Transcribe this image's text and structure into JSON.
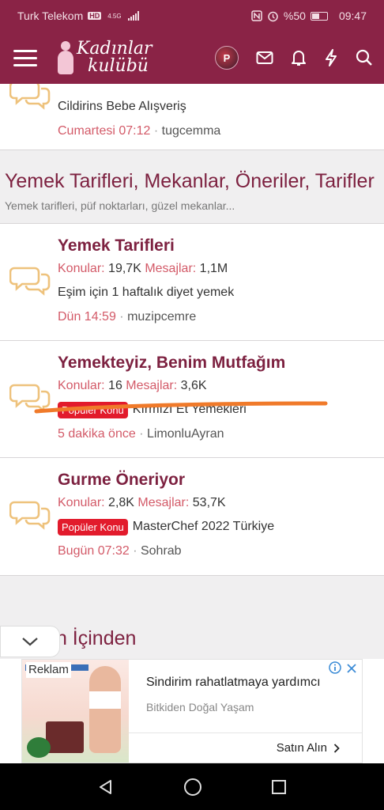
{
  "status_bar": {
    "carrier": "Turk Telekom",
    "hd_badge": "HD",
    "network": "4.5G",
    "battery": "%50",
    "time": "09:47"
  },
  "header": {
    "logo_line1": "Kadınlar",
    "logo_line2": "kulübü",
    "avatar_letter": "P"
  },
  "top_partial": {
    "last_title": "Cildirins Bebe Alışveriş",
    "time": "Cumartesi 07:12",
    "separator": "·",
    "user": "tugcemma"
  },
  "category": {
    "title": "Yemek Tarifleri, Mekanlar, Öneriler, Tarifler",
    "description": "Yemek tarifleri, püf noktarları, güzel mekanlar..."
  },
  "nodes": [
    {
      "title": "Yemek Tarifleri",
      "threads_label": "Konular:",
      "threads": "19,7K",
      "messages_label": "Mesajlar:",
      "messages": "1,1M",
      "badge": "",
      "last_title": "Eşim için 1 haftalık diyet yemek",
      "time": "Dün 14:59",
      "separator": "·",
      "user": "muzipcemre"
    },
    {
      "title": "Yemekteyiz, Benim Mutfağım",
      "threads_label": "Konular:",
      "threads": "16",
      "messages_label": "Mesajlar:",
      "messages": "3,6K",
      "badge": "Popüler Konu",
      "last_title": "Kırmızı Et Yemekleri",
      "time": "5 dakika önce",
      "separator": "·",
      "user": "LimonluAyran"
    },
    {
      "title": "Gurme Öneriyor",
      "threads_label": "Konular:",
      "threads": "2,8K",
      "messages_label": "Mesajlar:",
      "messages": "53,7K",
      "badge": "Popüler Konu",
      "last_title": "MasterChef 2022 Türkiye",
      "time": "Bugün 07:32",
      "separator": "·",
      "user": "Sohrab"
    }
  ],
  "next_category_partial": "ın İçinden",
  "ad": {
    "label": "Reklam",
    "headline": "Sindirim rahatlatmaya yardımcı",
    "advertiser": "Bitkiden Doğal Yaşam",
    "cta": "Satın Alın"
  },
  "colors": {
    "brand": "#8a2346",
    "title": "#7d2140",
    "accent": "#d35a68",
    "badge": "#e21b2c",
    "annotation": "#f07a2a"
  }
}
